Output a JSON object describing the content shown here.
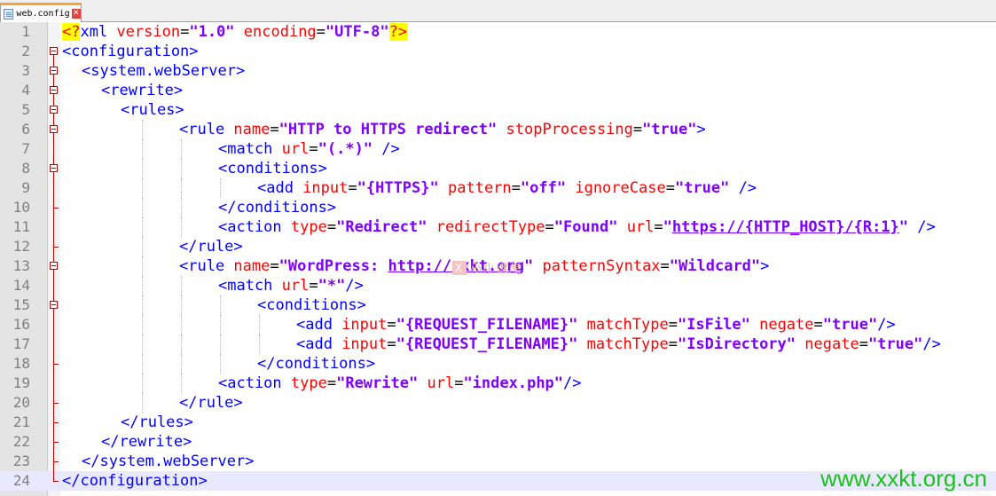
{
  "tab": {
    "label": "web.config",
    "icon": "xml-file-icon",
    "close_icon": "close-icon"
  },
  "watermarks": {
    "center_text": "小小课堂",
    "center_mark": "X",
    "corner_text": "www.xxkt.org.cn"
  },
  "colors": {
    "tag": "#0000ff",
    "attribute": "#ff0000",
    "value": "#8000ff",
    "fold_marker": "#c00000",
    "current_line": "#e8e8ff",
    "watermark_corner": "#19c219"
  },
  "editor": {
    "current_line": 24,
    "lines": [
      {
        "num": "1",
        "fold": "none",
        "indent": 0,
        "guides": 0,
        "tokens": [
          {
            "k": "d",
            "t": "<?"
          },
          {
            "k": "t",
            "t": "xml "
          },
          {
            "k": "a",
            "t": "version"
          },
          {
            "k": "p",
            "t": "="
          },
          {
            "k": "v",
            "t": "\"1.0\""
          },
          {
            "k": "p",
            "t": " "
          },
          {
            "k": "a",
            "t": "encoding"
          },
          {
            "k": "p",
            "t": "="
          },
          {
            "k": "v",
            "t": "\"UTF-8\""
          },
          {
            "k": "d",
            "t": "?>"
          }
        ]
      },
      {
        "num": "2",
        "fold": "open",
        "indent": 0,
        "guides": 0,
        "tokens": [
          {
            "k": "t",
            "t": "<configuration>"
          }
        ]
      },
      {
        "num": "3",
        "fold": "open",
        "indent": 2,
        "guides": 0,
        "tokens": [
          {
            "k": "t",
            "t": "<system.webServer>"
          }
        ]
      },
      {
        "num": "4",
        "fold": "open",
        "indent": 4,
        "guides": 0,
        "tokens": [
          {
            "k": "t",
            "t": "<rewrite>"
          }
        ]
      },
      {
        "num": "5",
        "fold": "open",
        "indent": 6,
        "guides": 0,
        "tokens": [
          {
            "k": "t",
            "t": "<rules>"
          }
        ]
      },
      {
        "num": "6",
        "fold": "open",
        "indent": 12,
        "guides": 1,
        "tokens": [
          {
            "k": "t",
            "t": "<rule "
          },
          {
            "k": "a",
            "t": "name"
          },
          {
            "k": "p",
            "t": "="
          },
          {
            "k": "v",
            "t": "\"HTTP to HTTPS redirect\""
          },
          {
            "k": "p",
            "t": " "
          },
          {
            "k": "a",
            "t": "stopProcessing"
          },
          {
            "k": "p",
            "t": "="
          },
          {
            "k": "v",
            "t": "\"true\""
          },
          {
            "k": "t",
            "t": ">"
          }
        ]
      },
      {
        "num": "7",
        "fold": "line",
        "indent": 16,
        "guides": 2,
        "tokens": [
          {
            "k": "t",
            "t": "<match "
          },
          {
            "k": "a",
            "t": "url"
          },
          {
            "k": "p",
            "t": "="
          },
          {
            "k": "v",
            "t": "\"(.*)\""
          },
          {
            "k": "p",
            "t": " "
          },
          {
            "k": "t",
            "t": "/>"
          }
        ]
      },
      {
        "num": "8",
        "fold": "open",
        "indent": 16,
        "guides": 2,
        "tokens": [
          {
            "k": "t",
            "t": "<conditions>"
          }
        ]
      },
      {
        "num": "9",
        "fold": "line",
        "indent": 20,
        "guides": 3,
        "tokens": [
          {
            "k": "t",
            "t": "<add "
          },
          {
            "k": "a",
            "t": "input"
          },
          {
            "k": "p",
            "t": "="
          },
          {
            "k": "v",
            "t": "\"{HTTPS}\""
          },
          {
            "k": "p",
            "t": " "
          },
          {
            "k": "a",
            "t": "pattern"
          },
          {
            "k": "p",
            "t": "="
          },
          {
            "k": "v",
            "t": "\"off\""
          },
          {
            "k": "p",
            "t": " "
          },
          {
            "k": "a",
            "t": "ignoreCase"
          },
          {
            "k": "p",
            "t": "="
          },
          {
            "k": "v",
            "t": "\"true\""
          },
          {
            "k": "p",
            "t": " "
          },
          {
            "k": "t",
            "t": "/>"
          }
        ]
      },
      {
        "num": "10",
        "fold": "end",
        "indent": 16,
        "guides": 2,
        "tokens": [
          {
            "k": "t",
            "t": "</conditions>"
          }
        ]
      },
      {
        "num": "11",
        "fold": "line",
        "indent": 16,
        "guides": 2,
        "tokens": [
          {
            "k": "t",
            "t": "<action "
          },
          {
            "k": "a",
            "t": "type"
          },
          {
            "k": "p",
            "t": "="
          },
          {
            "k": "v",
            "t": "\"Redirect\""
          },
          {
            "k": "p",
            "t": " "
          },
          {
            "k": "a",
            "t": "redirectType"
          },
          {
            "k": "p",
            "t": "="
          },
          {
            "k": "v",
            "t": "\"Found\""
          },
          {
            "k": "p",
            "t": " "
          },
          {
            "k": "a",
            "t": "url"
          },
          {
            "k": "p",
            "t": "="
          },
          {
            "k": "v",
            "t": "\""
          },
          {
            "k": "u",
            "t": "https://{HTTP_HOST}/{R:1}"
          },
          {
            "k": "v",
            "t": "\""
          },
          {
            "k": "p",
            "t": " "
          },
          {
            "k": "t",
            "t": "/>"
          }
        ]
      },
      {
        "num": "12",
        "fold": "end",
        "indent": 12,
        "guides": 1,
        "tokens": [
          {
            "k": "t",
            "t": "</rule>"
          }
        ]
      },
      {
        "num": "13",
        "fold": "open",
        "indent": 12,
        "guides": 1,
        "tokens": [
          {
            "k": "t",
            "t": "<rule "
          },
          {
            "k": "a",
            "t": "name"
          },
          {
            "k": "p",
            "t": "="
          },
          {
            "k": "v",
            "t": "\"WordPress: "
          },
          {
            "k": "u",
            "t": "http://xxkt.org"
          },
          {
            "k": "v",
            "t": "\""
          },
          {
            "k": "p",
            "t": " "
          },
          {
            "k": "a",
            "t": "patternSyntax"
          },
          {
            "k": "p",
            "t": "="
          },
          {
            "k": "v",
            "t": "\"Wildcard\""
          },
          {
            "k": "t",
            "t": ">"
          }
        ]
      },
      {
        "num": "14",
        "fold": "line",
        "indent": 16,
        "guides": 2,
        "tokens": [
          {
            "k": "t",
            "t": "<match "
          },
          {
            "k": "a",
            "t": "url"
          },
          {
            "k": "p",
            "t": "="
          },
          {
            "k": "v",
            "t": "\"*\""
          },
          {
            "k": "t",
            "t": "/>"
          }
        ]
      },
      {
        "num": "15",
        "fold": "open",
        "indent": 20,
        "guides": 3,
        "tokens": [
          {
            "k": "t",
            "t": "<conditions>"
          }
        ]
      },
      {
        "num": "16",
        "fold": "line",
        "indent": 24,
        "guides": 4,
        "tokens": [
          {
            "k": "t",
            "t": "<add "
          },
          {
            "k": "a",
            "t": "input"
          },
          {
            "k": "p",
            "t": "="
          },
          {
            "k": "v",
            "t": "\"{REQUEST_FILENAME}\""
          },
          {
            "k": "p",
            "t": " "
          },
          {
            "k": "a",
            "t": "matchType"
          },
          {
            "k": "p",
            "t": "="
          },
          {
            "k": "v",
            "t": "\"IsFile\""
          },
          {
            "k": "p",
            "t": " "
          },
          {
            "k": "a",
            "t": "negate"
          },
          {
            "k": "p",
            "t": "="
          },
          {
            "k": "v",
            "t": "\"true\""
          },
          {
            "k": "t",
            "t": "/>"
          }
        ]
      },
      {
        "num": "17",
        "fold": "line",
        "indent": 24,
        "guides": 4,
        "tokens": [
          {
            "k": "t",
            "t": "<add "
          },
          {
            "k": "a",
            "t": "input"
          },
          {
            "k": "p",
            "t": "="
          },
          {
            "k": "v",
            "t": "\"{REQUEST_FILENAME}\""
          },
          {
            "k": "p",
            "t": " "
          },
          {
            "k": "a",
            "t": "matchType"
          },
          {
            "k": "p",
            "t": "="
          },
          {
            "k": "v",
            "t": "\"IsDirectory\""
          },
          {
            "k": "p",
            "t": " "
          },
          {
            "k": "a",
            "t": "negate"
          },
          {
            "k": "p",
            "t": "="
          },
          {
            "k": "v",
            "t": "\"true\""
          },
          {
            "k": "t",
            "t": "/>"
          }
        ]
      },
      {
        "num": "18",
        "fold": "end",
        "indent": 20,
        "guides": 3,
        "tokens": [
          {
            "k": "t",
            "t": "</conditions>"
          }
        ]
      },
      {
        "num": "19",
        "fold": "line",
        "indent": 16,
        "guides": 2,
        "tokens": [
          {
            "k": "t",
            "t": "<action "
          },
          {
            "k": "a",
            "t": "type"
          },
          {
            "k": "p",
            "t": "="
          },
          {
            "k": "v",
            "t": "\"Rewrite\""
          },
          {
            "k": "p",
            "t": " "
          },
          {
            "k": "a",
            "t": "url"
          },
          {
            "k": "p",
            "t": "="
          },
          {
            "k": "v",
            "t": "\"index.php\""
          },
          {
            "k": "t",
            "t": "/>"
          }
        ]
      },
      {
        "num": "20",
        "fold": "end",
        "indent": 12,
        "guides": 1,
        "tokens": [
          {
            "k": "t",
            "t": "</rule>"
          }
        ]
      },
      {
        "num": "21",
        "fold": "end",
        "indent": 6,
        "guides": 0,
        "tokens": [
          {
            "k": "t",
            "t": "</rules>"
          }
        ]
      },
      {
        "num": "22",
        "fold": "end",
        "indent": 4,
        "guides": 0,
        "tokens": [
          {
            "k": "t",
            "t": "</rewrite>"
          }
        ]
      },
      {
        "num": "23",
        "fold": "end",
        "indent": 2,
        "guides": 0,
        "tokens": [
          {
            "k": "t",
            "t": "</system.webServer>"
          }
        ]
      },
      {
        "num": "24",
        "fold": "end",
        "indent": 0,
        "guides": 0,
        "tokens": [
          {
            "k": "t",
            "t": "</configuration>"
          }
        ]
      }
    ]
  }
}
